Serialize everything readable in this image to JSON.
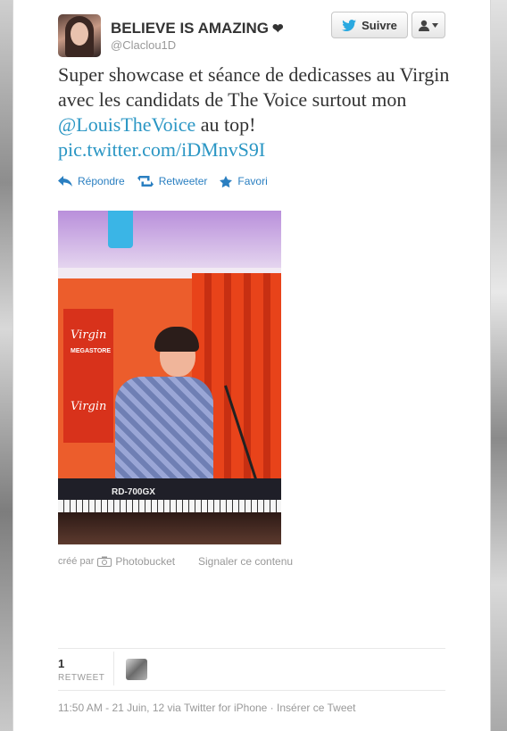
{
  "user": {
    "display_name": "BELIEVE IS AMAZING",
    "heart": "❤",
    "handle": "@Claclou1D"
  },
  "header": {
    "follow_label": "Suivre",
    "icons": [
      "twitter-bird-icon",
      "user-icon",
      "caret-down-icon"
    ]
  },
  "tweet": {
    "text_before_mention": "Super showcase et séance de dedicasses au Virgin avec les candidats de The Voice surtout mon ",
    "mention": "@LouisTheVoice",
    "text_after_mention": " au top!",
    "link": "pic.twitter.com/iDMnvS9I"
  },
  "actions": {
    "reply_label": "Répondre",
    "retweet_label": "Retweeter",
    "favorite_label": "Favori"
  },
  "photo": {
    "banner_text_1": "Virgin",
    "banner_text_2": "MEGASTORE",
    "banner_text_3": "Virgin",
    "keyboard_text": "RD-700GX"
  },
  "attribution": {
    "created_by_label": "créé par",
    "service": "Photobucket",
    "report_label": "Signaler ce contenu"
  },
  "stats": {
    "retweet_count": "1",
    "retweet_label": "RETWEET"
  },
  "footer": {
    "timestamp": "11:50 AM - 21 Juin, 12 via Twitter for iPhone · Insérer ce Tweet"
  },
  "colors": {
    "link": "#2a96c4",
    "action": "#2a7fc1",
    "muted": "#999999"
  }
}
